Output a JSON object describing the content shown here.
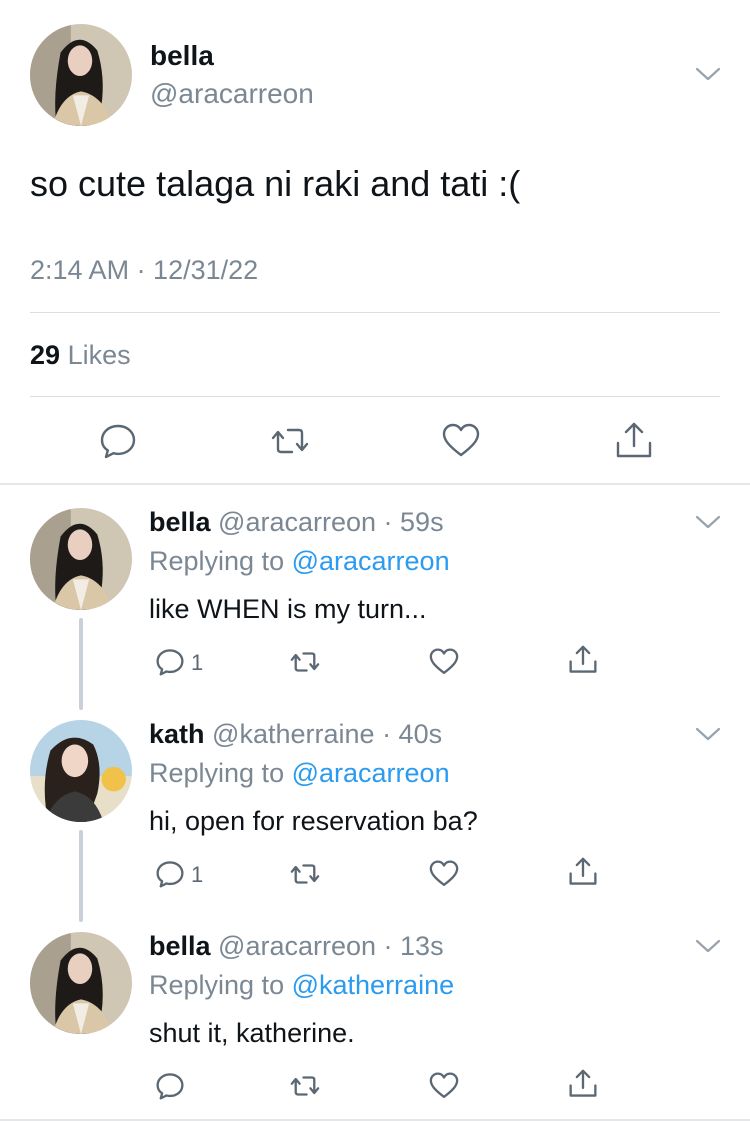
{
  "main_tweet": {
    "name": "bella",
    "handle": "@aracarreon",
    "text": "so cute talaga ni raki and tati :(",
    "timestamp": "2:14 AM · 12/31/22",
    "likes_count": "29",
    "likes_label": "Likes",
    "avatar_icon": "profile-photo",
    "actions": [
      "reply-icon",
      "retweet-icon",
      "like-icon",
      "share-icon"
    ]
  },
  "replies": [
    {
      "name": "bella",
      "handle": "@aracarreon",
      "time": "· 59s",
      "replying_label": "Replying to",
      "replying_to": "@aracarreon",
      "text": "like WHEN is my turn...",
      "reply_count": "1"
    },
    {
      "name": "kath",
      "handle": "@katherraine",
      "time": "· 40s",
      "replying_label": "Replying to",
      "replying_to": "@aracarreon",
      "text": "hi, open for reservation ba?",
      "reply_count": "1"
    },
    {
      "name": "bella",
      "handle": "@aracarreon",
      "time": "· 13s",
      "replying_label": "Replying to",
      "replying_to": "@katherraine",
      "text": "shut it, katherine.",
      "reply_count": ""
    }
  ],
  "colors": {
    "link_blue": "#2b9bf0",
    "secondary_gray": "#7b8894",
    "divider": "#dcdfe2",
    "thread_line": "#c9d1d8"
  }
}
